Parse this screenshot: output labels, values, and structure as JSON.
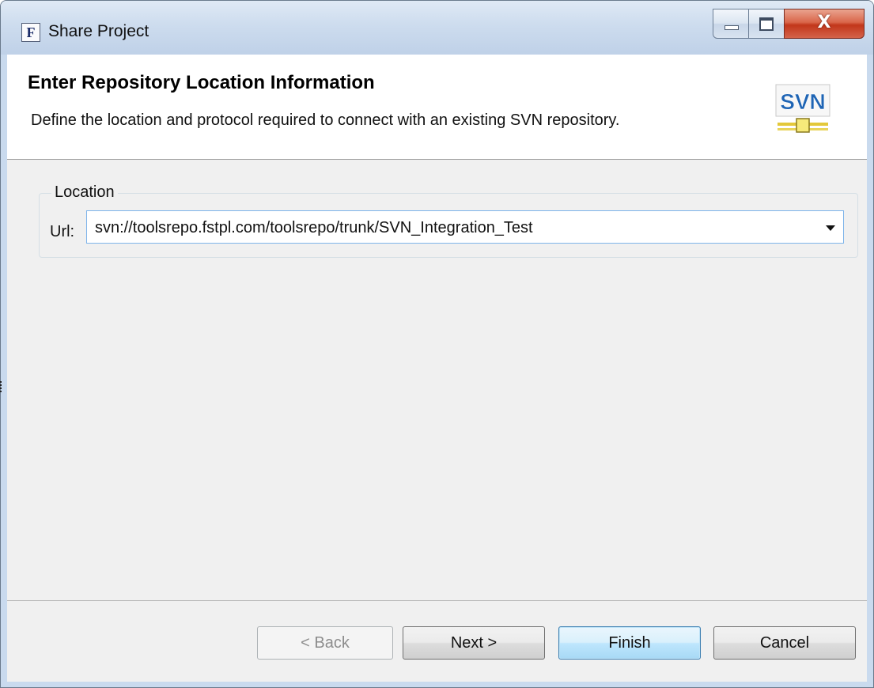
{
  "window": {
    "title": "Share Project",
    "app_icon_letter": "F",
    "controls": {
      "minimize": "minimize",
      "maximize": "maximize",
      "close": "X"
    }
  },
  "header": {
    "title": "Enter Repository Location Information",
    "description": "Define the location and protocol required to connect with an existing SVN repository.",
    "icon_text": "SVN"
  },
  "location": {
    "group_label": "Location",
    "url_label": "Url:",
    "url_value": "svn://toolsrepo.fstpl.com/toolsrepo/trunk/SVN_Integration_Test"
  },
  "buttons": {
    "back": "< Back",
    "next": "Next >",
    "finish": "Finish",
    "cancel": "Cancel"
  },
  "colors": {
    "title_bar": "#c9daee",
    "close_button": "#c2361a",
    "default_button_border": "#3c7fb1",
    "svn_icon_text": "#1e64b4",
    "svn_icon_bar": "#e3c83a"
  }
}
